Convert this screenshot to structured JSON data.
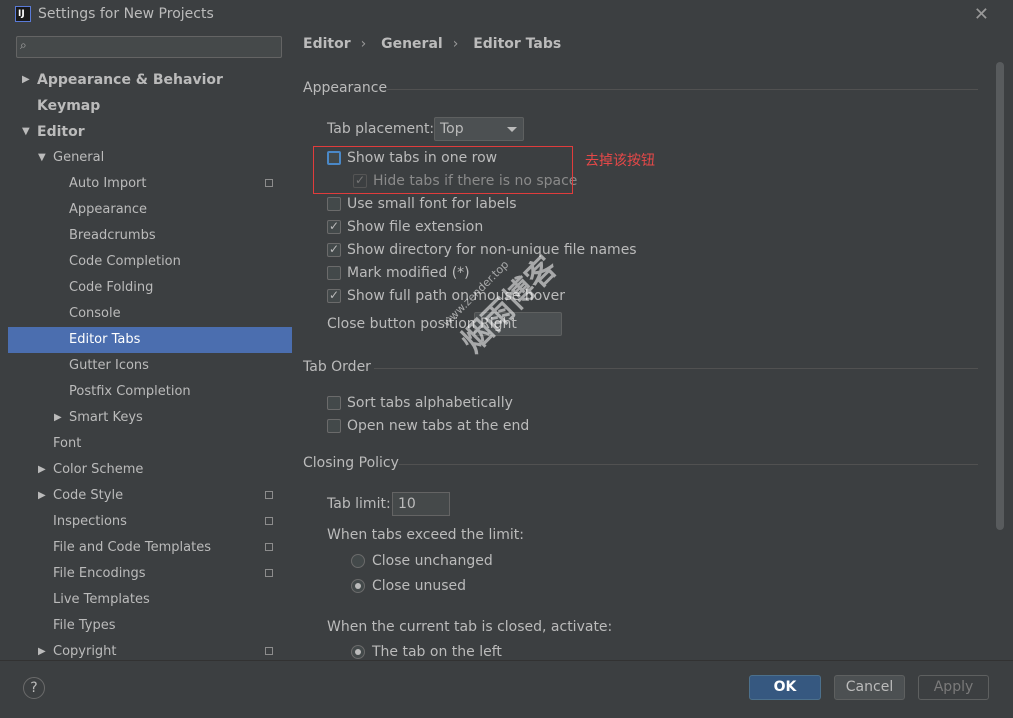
{
  "window": {
    "title": "Settings for New Projects",
    "icon_label": "IJ"
  },
  "search": {
    "placeholder": "",
    "value": ""
  },
  "sidebar": {
    "items": [
      {
        "label": "Appearance & Behavior",
        "arrow": "▶",
        "bold": true
      },
      {
        "label": "Keymap",
        "arrow": "",
        "bold": true
      },
      {
        "label": "Editor",
        "arrow": "▼",
        "bold": true
      },
      {
        "label": "General",
        "arrow": "▼"
      },
      {
        "label": "Auto Import",
        "project": true
      },
      {
        "label": "Appearance"
      },
      {
        "label": "Breadcrumbs"
      },
      {
        "label": "Code Completion"
      },
      {
        "label": "Code Folding"
      },
      {
        "label": "Console"
      },
      {
        "label": "Editor Tabs",
        "selected": true
      },
      {
        "label": "Gutter Icons"
      },
      {
        "label": "Postfix Completion"
      },
      {
        "label": "Smart Keys",
        "arrow": "▶"
      },
      {
        "label": "Font"
      },
      {
        "label": "Color Scheme",
        "arrow": "▶"
      },
      {
        "label": "Code Style",
        "arrow": "▶",
        "project": true
      },
      {
        "label": "Inspections",
        "project": true
      },
      {
        "label": "File and Code Templates",
        "project": true
      },
      {
        "label": "File Encodings",
        "project": true
      },
      {
        "label": "Live Templates"
      },
      {
        "label": "File Types"
      },
      {
        "label": "Copyright",
        "arrow": "▶",
        "project": true
      }
    ]
  },
  "breadcrumb": {
    "items": [
      "Editor",
      "General",
      "Editor Tabs"
    ],
    "separator": "›"
  },
  "appearance": {
    "title": "Appearance",
    "tab_placement_label": "Tab placement:",
    "tab_placement_value": "Top",
    "show_tabs_one_row": {
      "label": "Show tabs in one row",
      "checked": false
    },
    "hide_tabs_no_space": {
      "label": "Hide tabs if there is no space",
      "checked": true
    },
    "small_font": {
      "label": "Use small font for labels",
      "checked": false
    },
    "show_file_ext": {
      "label": "Show file extension",
      "checked": true
    },
    "show_dir": {
      "label": "Show directory for non-unique file names",
      "checked": true
    },
    "mark_modified": {
      "label": "Mark modified (*)",
      "checked": false
    },
    "show_full_path": {
      "label": "Show full path on mouse hover",
      "checked": true
    },
    "close_button_label": "Close button position:",
    "close_button_value": "Right"
  },
  "annotation": {
    "text": "去掉该按钮",
    "color": "#e64848"
  },
  "watermark": {
    "text": "烟雨博客",
    "url": "www.zender.top"
  },
  "tab_order": {
    "title": "Tab Order",
    "sort_alpha": {
      "label": "Sort tabs alphabetically",
      "checked": false
    },
    "open_end": {
      "label": "Open new tabs at the end",
      "checked": false
    }
  },
  "closing_policy": {
    "title": "Closing Policy",
    "tab_limit_label": "Tab limit:",
    "tab_limit_value": "10",
    "exceed_label": "When tabs exceed the limit:",
    "close_unchanged": {
      "label": "Close unchanged",
      "selected": false
    },
    "close_unused": {
      "label": "Close unused",
      "selected": true
    },
    "activate_label": "When the current tab is closed, activate:",
    "tab_left": {
      "label": "The tab on the left",
      "selected": true
    }
  },
  "buttons": {
    "help": "?",
    "ok": "OK",
    "cancel": "Cancel",
    "apply": "Apply"
  },
  "colors": {
    "background": "#3c3f41",
    "selection": "#4b6eaf",
    "ok_button": "#365880"
  }
}
